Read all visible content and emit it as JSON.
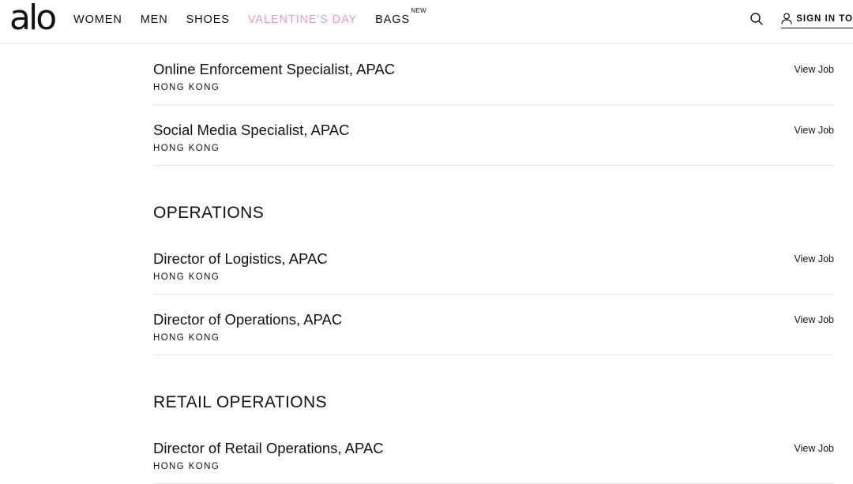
{
  "header": {
    "logo": "alo",
    "nav": [
      {
        "label": "WOMEN"
      },
      {
        "label": "MEN"
      },
      {
        "label": "SHOES"
      },
      {
        "label": "VALENTINE'S DAY"
      },
      {
        "label": "BAGS",
        "badge": "NEW"
      }
    ],
    "sign_in_label": "SIGN IN TO"
  },
  "colors": {
    "accent_pink": "#e89bc9",
    "text": "#111111",
    "divider": "#e6e6e6"
  },
  "sections": [
    {
      "heading": "",
      "jobs": [
        {
          "title": "Online Enforcement Specialist, APAC",
          "location": "HONG KONG",
          "action": "View Job"
        },
        {
          "title": "Social Media Specialist, APAC",
          "location": "HONG KONG",
          "action": "View Job"
        }
      ]
    },
    {
      "heading": "OPERATIONS",
      "jobs": [
        {
          "title": "Director of Logistics, APAC",
          "location": "HONG KONG",
          "action": "View Job"
        },
        {
          "title": "Director of Operations, APAC",
          "location": "HONG KONG",
          "action": "View Job"
        }
      ]
    },
    {
      "heading": "RETAIL OPERATIONS",
      "jobs": [
        {
          "title": "Director of Retail Operations, APAC",
          "location": "HONG KONG",
          "action": "View Job"
        }
      ]
    }
  ]
}
